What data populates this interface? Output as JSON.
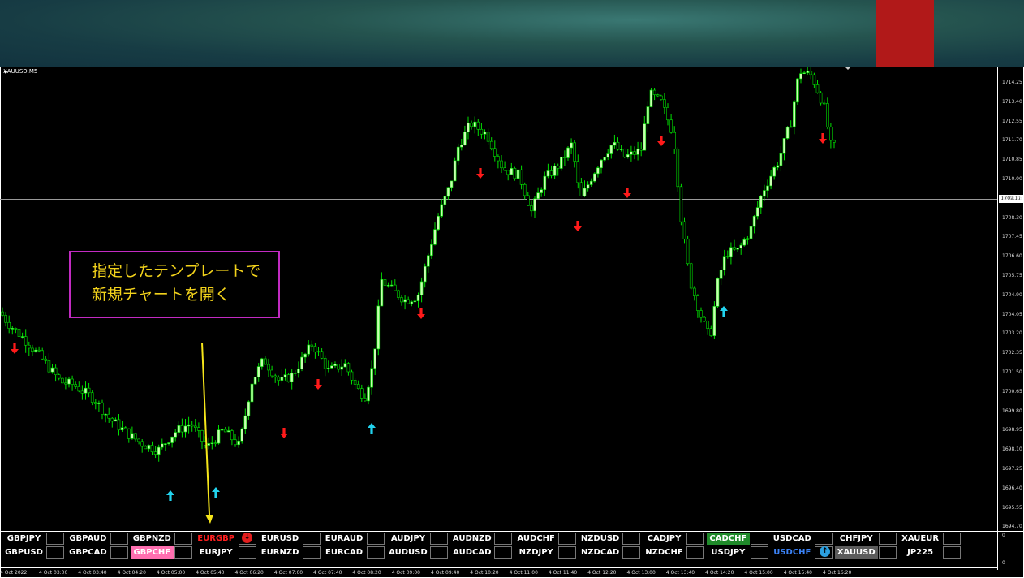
{
  "chart": {
    "symbol": "XAUUSD,M5",
    "current_price": "1709.11",
    "price_axis": [
      "1714.25",
      "1713.40",
      "1712.55",
      "1711.70",
      "1710.85",
      "1710.00",
      "1709.15",
      "1708.30",
      "1707.45",
      "1706.60",
      "1705.75",
      "1704.90",
      "1704.05",
      "1703.20",
      "1702.35",
      "1701.50",
      "1700.65",
      "1699.80",
      "1698.95",
      "1698.10",
      "1697.25",
      "1696.40",
      "1695.55",
      "1694.70"
    ],
    "indicator_axis": [
      "0",
      "0"
    ],
    "time_axis": [
      "4 Oct 2022",
      "4 Oct 03:00",
      "4 Oct 03:40",
      "4 Oct 04:20",
      "4 Oct 05:00",
      "4 Oct 05:40",
      "4 Oct 06:20",
      "4 Oct 07:00",
      "4 Oct 07:40",
      "4 Oct 08:20",
      "4 Oct 09:00",
      "4 Oct 09:40",
      "4 Oct 10:20",
      "4 Oct 11:00",
      "4 Oct 11:40",
      "4 Oct 12:20",
      "4 Oct 13:00",
      "4 Oct 13:40",
      "4 Oct 14:20",
      "4 Oct 15:00",
      "4 Oct 15:40",
      "4 Oct 16:20"
    ],
    "colors": {
      "bull": "#c8ffb0",
      "bear": "#000000",
      "wick": "#00e000",
      "up_arrow": "#22d3ee",
      "down_arrow": "#ff1a1a"
    }
  },
  "annotation": {
    "line1": "指定したテンプレートで",
    "line2": "新規チャートを開く"
  },
  "symbol_panel": {
    "row1": [
      "GBPJPY",
      "GBPAUD",
      "GBPNZD",
      "EURGBP",
      "EURUSD",
      "EURAUD",
      "AUDJPY",
      "AUDNZD",
      "AUDCHF",
      "NZDUSD",
      "CADJPY",
      "CADCHF",
      "USDCAD",
      "CHFJPY",
      "XAUEUR"
    ],
    "row2": [
      "GBPUSD",
      "GBPCAD",
      "GBPCHF",
      "EURJPY",
      "EURNZD",
      "EURCAD",
      "AUDUSD",
      "AUDCAD",
      "NZDJPY",
      "NZDCAD",
      "NZDCHF",
      "USDJPY",
      "USDCHF",
      "XAUUSD",
      "JP225"
    ],
    "styles": {
      "EURGBP": {
        "fg": "#ff2020",
        "bg": "#000000"
      },
      "GBPCHF": {
        "fg": "#ffffff",
        "bg": "#ff6fb0"
      },
      "CADCHF": {
        "fg": "#ffffff",
        "bg": "#1f8a2a"
      },
      "USDCHF": {
        "fg": "#3b82f6",
        "bg": "#000000"
      },
      "XAUUSD": {
        "fg": "#ffffff",
        "bg": "#5c5c5c"
      }
    },
    "badges": {
      "row1_badge": "down-signal-badge",
      "row2_badge": "up-signal-badge"
    }
  }
}
